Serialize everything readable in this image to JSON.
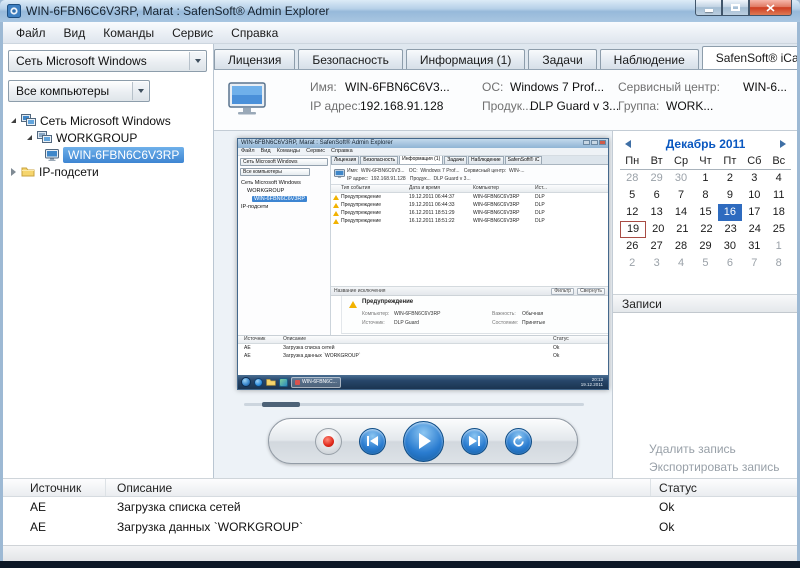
{
  "window": {
    "title": "WIN-6FBN6C6V3RP, Marat : SafenSoft® Admin Explorer"
  },
  "menu": {
    "items": [
      "Файл",
      "Вид",
      "Команды",
      "Сервис",
      "Справка"
    ]
  },
  "sidebar": {
    "network_filter": "Сеть Microsoft Windows",
    "computer_filter": "Все компьютеры",
    "tree": {
      "network": "Сеть Microsoft Windows",
      "workgroup": "WORKGROUP",
      "computer": "WIN-6FBN6C6V3RP",
      "subnets": "IP-подсети"
    }
  },
  "tabs": {
    "license": "Лицензия",
    "security": "Безопасность",
    "information": "Информация (1)",
    "tasks": "Задачи",
    "observation": "Наблюдение",
    "icam": "SafenSoft® iCa"
  },
  "computer_info": {
    "name_label": "Имя:",
    "name": "WIN-6FBN6C6V3...",
    "os_label": "ОС:",
    "os": "Windows 7 Prof...",
    "service_center_label": "Сервисный центр:",
    "service_center": "WIN-6...",
    "ip_label": "IP адрес:",
    "ip": "192.168.91.128",
    "product_label": "Продук...",
    "product": "DLP Guard v 3...",
    "group_label": "Группа:",
    "group": "WORK..."
  },
  "calendar": {
    "title": "Декабрь 2011",
    "weekdays": [
      "Пн",
      "Вт",
      "Ср",
      "Чт",
      "Пт",
      "Сб",
      "Вс"
    ],
    "weeks": [
      [
        "28",
        "29",
        "30",
        "1",
        "2",
        "3",
        "4"
      ],
      [
        "5",
        "6",
        "7",
        "8",
        "9",
        "10",
        "11"
      ],
      [
        "12",
        "13",
        "14",
        "15",
        "16",
        "17",
        "18"
      ],
      [
        "19",
        "20",
        "21",
        "22",
        "23",
        "24",
        "25"
      ],
      [
        "26",
        "27",
        "28",
        "29",
        "30",
        "31",
        "1"
      ],
      [
        "2",
        "3",
        "4",
        "5",
        "6",
        "7",
        "8"
      ]
    ],
    "selected_day": "16",
    "today_day": "19"
  },
  "records": {
    "title": "Записи",
    "delete_link": "Удалить запись",
    "export_link": "Экспортировать запись"
  },
  "log": {
    "columns": [
      "Источник",
      "Описание",
      "Статус"
    ],
    "rows": [
      [
        "AE",
        "Загрузка списка сетей",
        "Ok"
      ],
      [
        "AE",
        "Загрузка данных `WORKGROUP`",
        "Ok"
      ]
    ]
  },
  "preview": {
    "title": "WIN-6FBN6C6V3RP, Marat : SafenSoft® Admin Explorer",
    "menu": "Файл    Вид    Команды    Сервис    Справка",
    "network_filter": "Сеть Microsoft Windows",
    "computer_filter": "Все компьютеры",
    "tree": {
      "network": "Сеть Microsoft Windows",
      "workgroup": "WORKGROUP",
      "computer": "WIN-6FBN6C6V3RP",
      "subnets": "IP-подсети"
    },
    "tabs": [
      "Лицензия",
      "Безопасность",
      "Информация (1)",
      "Задачи",
      "Наблюдение",
      "SafenSoft® iC"
    ],
    "info_line1": "Имя:  WIN-6FBN6C6V3...   ОС:  Windows 7 Prof...   Сервисный центр:  WIN-...",
    "info_line2": "IP адрес:  192.168.91.128   Продук...  DLP Guard v 3...",
    "events": {
      "columns": [
        "Тип события",
        "Дата и время",
        "Компьютер",
        "Ист..."
      ],
      "rows": [
        [
          "Предупреждение",
          "19.12.2011 06:44:37",
          "WIN-6FBN6C6V3RP",
          "DLP"
        ],
        [
          "Предупреждение",
          "19.12.2011 06:44:33",
          "WIN-6FBN6C6V3RP",
          "DLP"
        ],
        [
          "Предупреждение",
          "16.12.2011 18:51:29",
          "WIN-6FBN6C6V3RP",
          "DLP"
        ],
        [
          "Предупреждение",
          "16.12.2011 18:51:22",
          "WIN-6FBN6C6V3RP",
          "DLP"
        ]
      ]
    },
    "toolbar": {
      "exclusion": "Название исключения",
      "filter": "Фильтр",
      "collapse": "Свернуть"
    },
    "detail": {
      "title": "Предупреждение",
      "computer_label": "Компьютер:",
      "computer": "WIN-6FBN6C6V3RP",
      "importance_label": "Важность:",
      "importance": "Обычная",
      "source_label": "Источник:",
      "source": "DLP Guard",
      "state_label": "Состояние:",
      "state": "Принятые"
    },
    "log": {
      "columns": [
        "Источник",
        "Описание",
        "Статус"
      ],
      "rows": [
        [
          "AE",
          "Загрузка списка сетей",
          "Ok"
        ],
        [
          "AE",
          "Загрузка данных `WORKGROUP`",
          "Ok"
        ]
      ]
    },
    "taskbar": {
      "task_button": "WIN-6FBN6C...",
      "time": "20:13",
      "date": "19.12.2011"
    }
  }
}
